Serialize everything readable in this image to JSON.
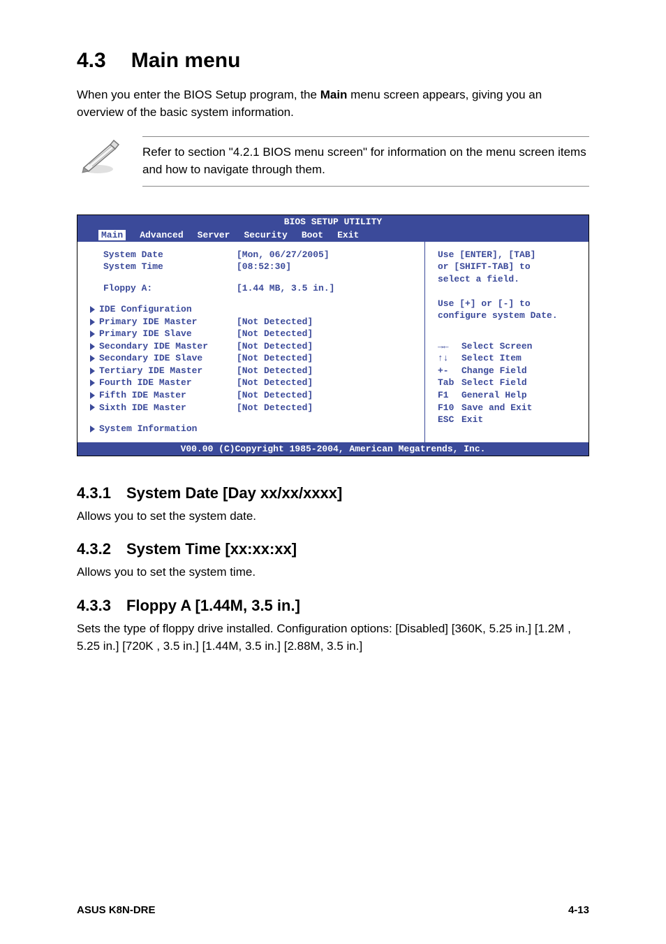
{
  "header": {
    "section_number": "4.3",
    "section_title": "Main menu"
  },
  "intro": {
    "text_before_bold": "When you enter the BIOS Setup program, the ",
    "bold_word": "Main",
    "text_after_bold": " menu screen appears, giving you an overview of the basic system information."
  },
  "note": {
    "text": "Refer to section \"4.2.1 BIOS menu screen\" for information on the menu screen items and how to navigate through them."
  },
  "bios": {
    "title": "BIOS SETUP UTILITY",
    "tabs": [
      "Main",
      "Advanced",
      "Server",
      "Security",
      "Boot",
      "Exit"
    ],
    "active_tab": "Main",
    "rows": [
      {
        "has_triangle": false,
        "label": "System Date",
        "value": "[Mon, 06/27/2005]"
      },
      {
        "has_triangle": false,
        "label": "System Time",
        "value": "[08:52:30]"
      },
      {
        "spacer": true
      },
      {
        "has_triangle": false,
        "label": "Floppy A:",
        "value": "[1.44 MB, 3.5 in.]"
      },
      {
        "spacer": true
      },
      {
        "has_triangle": true,
        "label": "IDE Configuration",
        "value": ""
      },
      {
        "has_triangle": true,
        "label": "Primary IDE Master",
        "value": "[Not Detected]"
      },
      {
        "has_triangle": true,
        "label": "Primary IDE Slave",
        "value": "[Not Detected]"
      },
      {
        "has_triangle": true,
        "label": "Secondary IDE Master",
        "value": "[Not Detected]"
      },
      {
        "has_triangle": true,
        "label": "Secondary IDE Slave",
        "value": "[Not Detected]"
      },
      {
        "has_triangle": true,
        "label": "Tertiary IDE Master",
        "value": "[Not Detected]"
      },
      {
        "has_triangle": true,
        "label": "Fourth IDE Master",
        "value": "[Not Detected]"
      },
      {
        "has_triangle": true,
        "label": "Fifth IDE Master",
        "value": "[Not Detected]"
      },
      {
        "has_triangle": true,
        "label": "Sixth IDE Master",
        "value": "[Not Detected]"
      },
      {
        "spacer": true
      },
      {
        "has_triangle": true,
        "label": "System Information",
        "value": ""
      }
    ],
    "help_top": [
      "Use [ENTER], [TAB]",
      "or [SHIFT-TAB] to",
      "select a field.",
      "",
      "Use [+] or [-] to",
      "configure system Date."
    ],
    "help_keys": [
      {
        "key": "→←",
        "desc": "Select Screen"
      },
      {
        "key": "↑↓",
        "desc": "Select Item"
      },
      {
        "key": "+-",
        "desc": "Change Field"
      },
      {
        "key": "Tab",
        "desc": "Select Field"
      },
      {
        "key": "F1",
        "desc": "General Help"
      },
      {
        "key": "F10",
        "desc": "Save and Exit"
      },
      {
        "key": "ESC",
        "desc": "Exit"
      }
    ],
    "footer": "V00.00 (C)Copyright 1985-2004, American Megatrends, Inc."
  },
  "subsections": {
    "s1_num": "4.3.1",
    "s1_title": "System Date [Day xx/xx/xxxx]",
    "s1_body": "Allows you to set the system date.",
    "s2_num": "4.3.2",
    "s2_title": "System Time [xx:xx:xx]",
    "s2_body": "Allows you to set the system time.",
    "s3_num": "4.3.3",
    "s3_title": "Floppy A [1.44M, 3.5 in.]",
    "s3_body": "Sets the type of floppy drive installed. Configuration options: [Disabled] [360K, 5.25 in.] [1.2M , 5.25 in.] [720K , 3.5 in.] [1.44M, 3.5 in.] [2.88M, 3.5 in.]"
  },
  "page_footer": {
    "left": "ASUS K8N-DRE",
    "right": "4-13"
  }
}
